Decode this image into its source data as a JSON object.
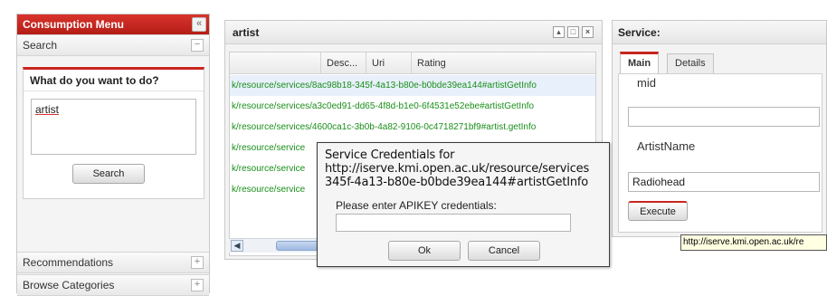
{
  "left_menu": {
    "title": "Consumption Menu",
    "collapse_icon": "double-chevron-left-icon",
    "search_section": "Search",
    "what_header": "What do you want to do?",
    "query_value": "artist",
    "search_button": "Search",
    "recommendations": "Recommendations",
    "browse_categories": "Browse Categories",
    "expand_symbol": "+",
    "collapse_symbol": "−"
  },
  "artist_panel": {
    "title": "artist",
    "columns": [
      "Desc...",
      "Uri",
      "Rating"
    ],
    "rows": [
      "k/resource/services/8ac98b18-345f-4a13-b80e-b0bde39ea144#artistGetInfo",
      "k/resource/services/a3c0ed91-dd65-4f8d-b1e0-6f4531e52ebe#artistGetInfo",
      "k/resource/services/4600ca1c-3b0b-4a82-9106-0c4718271bf9#artist.getInfo",
      "k/resource/service",
      "k/resource/service",
      "k/resource/service"
    ],
    "scroll_left_symbol": "◀"
  },
  "service_panel": {
    "title": "Service:",
    "tabs": [
      "Main",
      "Details"
    ],
    "field1_label": "mid",
    "field1_value": "",
    "field2_label": "ArtistName",
    "field2_value": "Radiohead",
    "execute_button": "Execute"
  },
  "tooltip": "http://iserve.kmi.open.ac.uk/re",
  "dialog": {
    "line1": "Service Credentials for",
    "line2": "http://iserve.kmi.open.ac.uk/resource/services",
    "line3": "345f-4a13-b80e-b0bde39ea144#artistGetInfo",
    "prompt": "Please enter APIKEY credentials:",
    "ok_button": "Ok",
    "cancel_button": "Cancel"
  },
  "colors": {
    "accent_red": "#c9251e",
    "link_green": "#1a8f1a"
  }
}
